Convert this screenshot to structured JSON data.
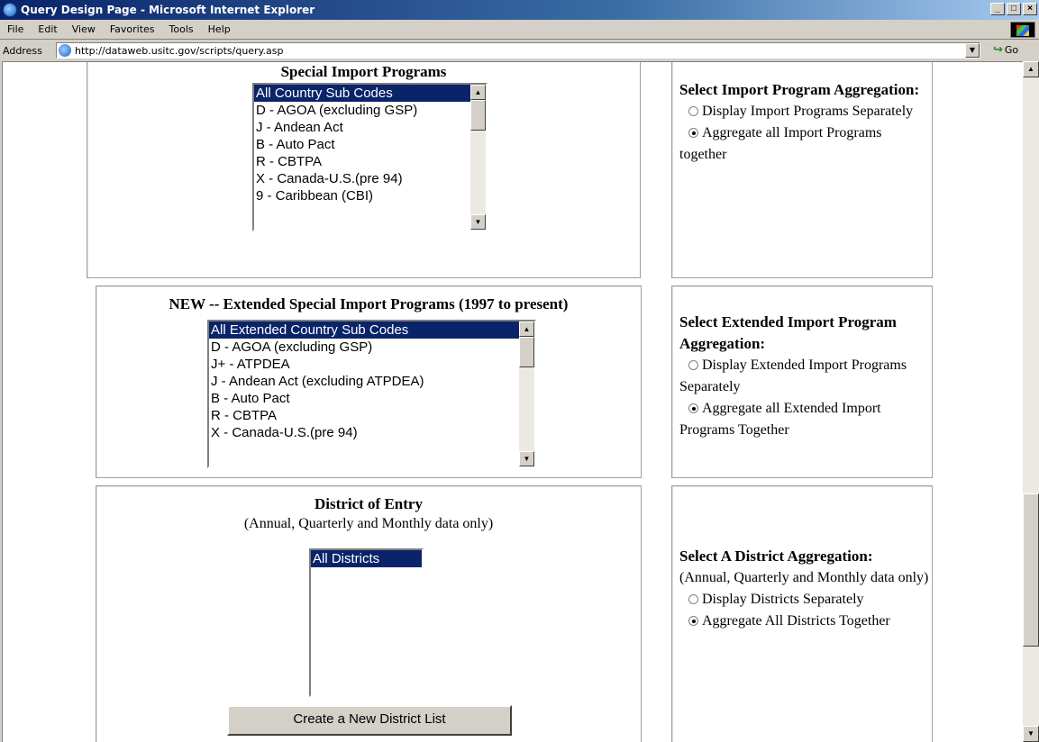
{
  "window": {
    "title": "Query Design Page - Microsoft Internet Explorer",
    "min_glyph": "_",
    "max_glyph": "□",
    "close_glyph": "×"
  },
  "menu": [
    "File",
    "Edit",
    "View",
    "Favorites",
    "Tools",
    "Help"
  ],
  "address": {
    "label": "Address",
    "url": "http://dataweb.usitc.gov/scripts/query.asp",
    "go_label": "Go"
  },
  "sections": {
    "special": {
      "title": "Special Import Programs",
      "options": [
        "All Country Sub Codes",
        "D - AGOA (excluding GSP)",
        "J - Andean Act",
        "B - Auto Pact",
        "R - CBTPA",
        "X - Canada-U.S.(pre 94)",
        "9 - Caribbean (CBI)"
      ],
      "selected_index": 0,
      "side": {
        "heading": "Select Import Program Aggregation:",
        "radio1": "Display Import Programs Separately",
        "radio2": "Aggregate all Import Programs together",
        "checked": 2
      }
    },
    "extended": {
      "title": "NEW -- Extended Special Import Programs (1997 to present)",
      "options": [
        "All Extended Country Sub Codes",
        "D - AGOA (excluding GSP)",
        "J+ - ATPDEA",
        "J - Andean Act (excluding ATPDEA)",
        "B - Auto Pact",
        "R - CBTPA",
        "X - Canada-U.S.(pre 94)"
      ],
      "selected_index": 0,
      "side": {
        "heading": "Select Extended Import Program Aggregation:",
        "radio1": "Display Extended Import Programs Separately",
        "radio2": "Aggregate all Extended Import Programs Together",
        "checked": 2
      }
    },
    "district": {
      "title": "District of Entry",
      "subtitle": "(Annual, Quarterly and Monthly data only)",
      "options": [
        "All Districts"
      ],
      "selected_index": 0,
      "button_label": "Create a New District List",
      "side": {
        "heading": "Select A District Aggregation:",
        "note": "(Annual, Quarterly and Monthly data only)",
        "radio1": "Display Districts Separately",
        "radio2": "Aggregate All Districts Together",
        "checked": 2
      }
    }
  },
  "colors": {
    "selection": "#0a246a",
    "chrome": "#d4d0c8"
  }
}
